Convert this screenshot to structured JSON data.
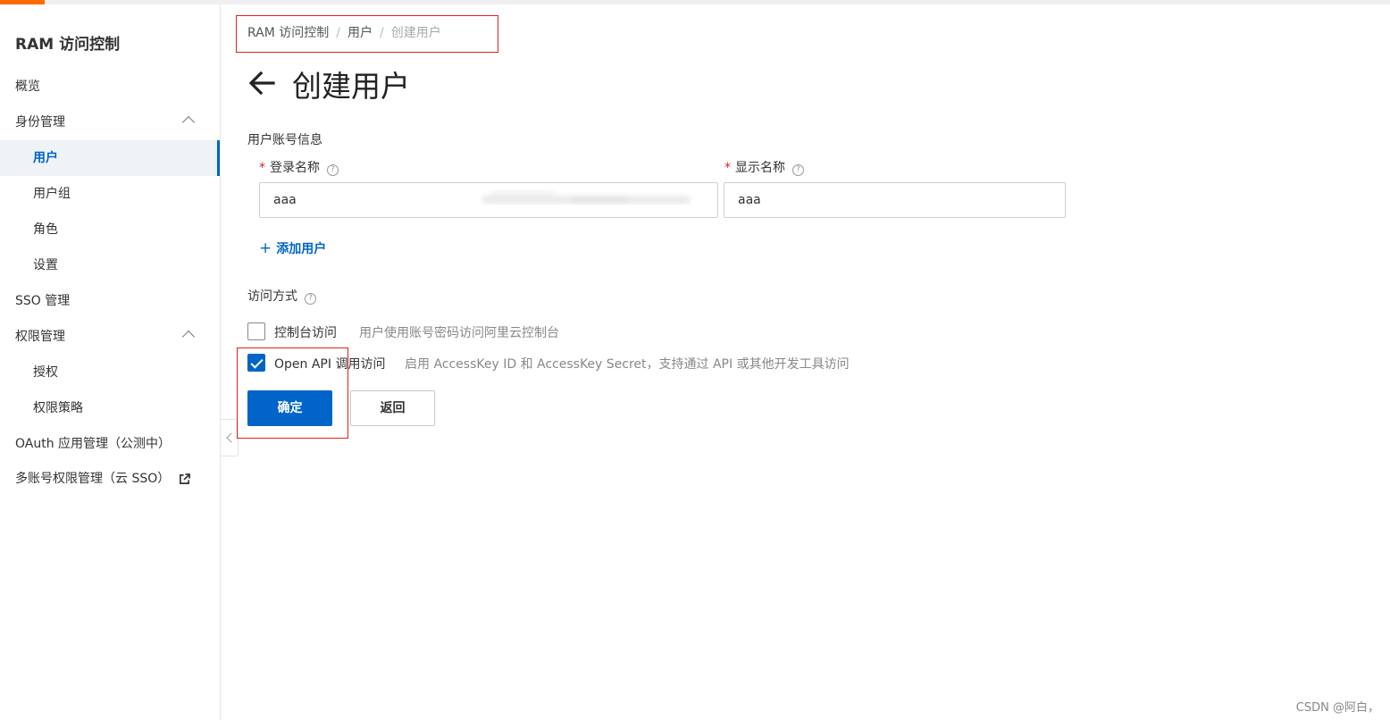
{
  "sidebar": {
    "title": "RAM 访问控制",
    "items": [
      {
        "label": "概览"
      },
      {
        "label": "身份管理"
      },
      {
        "label": "用户"
      },
      {
        "label": "用户组"
      },
      {
        "label": "角色"
      },
      {
        "label": "设置"
      },
      {
        "label": "SSO 管理"
      },
      {
        "label": "权限管理"
      },
      {
        "label": "授权"
      },
      {
        "label": "权限策略"
      },
      {
        "label": "OAuth 应用管理（公测中）"
      },
      {
        "label": "多账号权限管理（云 SSO）"
      }
    ]
  },
  "breadcrumb": {
    "items": [
      "RAM 访问控制",
      "用户",
      "创建用户"
    ],
    "separator": "/"
  },
  "page": {
    "title": "创建用户"
  },
  "account_info": {
    "section_label": "用户账号信息",
    "required_mark": "*",
    "login_name_label": "登录名称",
    "login_name_value": "aaa",
    "display_name_label": "显示名称",
    "display_name_value": "aaa",
    "help_glyph": "?",
    "add_user_plus": "+",
    "add_user_label": "添加用户"
  },
  "access": {
    "section_label": "访问方式",
    "console": {
      "label": "控制台访问",
      "description": "用户使用账号密码访问阿里云控制台",
      "checked": false
    },
    "api": {
      "label": "Open API 调用访问",
      "description": "启用 AccessKey ID 和 AccessKey Secret，支持通过 API 或其他开发工具访问",
      "checked": true
    }
  },
  "buttons": {
    "confirm": "确定",
    "back": "返回"
  },
  "watermark": "CSDN @阿白，",
  "colors": {
    "accent": "#ff6a00",
    "primary": "#0064c8",
    "highlight_box": "#e02020",
    "required": "#e02020"
  }
}
